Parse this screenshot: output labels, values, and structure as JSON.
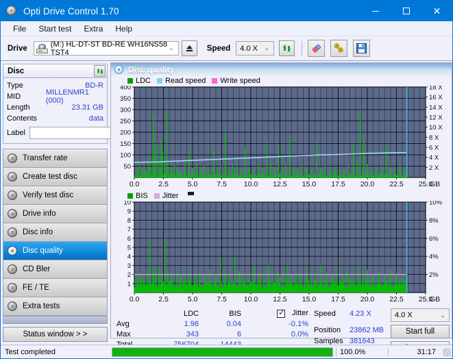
{
  "window": {
    "title": "Opti Drive Control 1.70",
    "icon": "disc-icon",
    "minimize": "–",
    "maximize": "□",
    "close": "✕"
  },
  "menu": {
    "items": [
      "File",
      "Start test",
      "Extra",
      "Help"
    ]
  },
  "toolbar": {
    "drive_label": "Drive",
    "drive_value": "(M:)   HL-DT-ST BD-RE  WH16NS58 TST4",
    "eject_icon": "eject-icon",
    "speed_label": "Speed",
    "speed_value": "4.0 X",
    "refresh_icon": "refresh-icon",
    "erase_icon": "eraser-icon",
    "tools_icon": "tools-icon",
    "save_icon": "save-icon"
  },
  "disc": {
    "header": "Disc",
    "refresh_icon": "refresh-icon",
    "rows": [
      {
        "key": "Type",
        "value": "BD-R"
      },
      {
        "key": "MID",
        "value": "MILLENMR1 (000)"
      },
      {
        "key": "Length",
        "value": "23.31 GB"
      },
      {
        "key": "Contents",
        "value": "data"
      }
    ],
    "label_key": "Label",
    "label_value": "",
    "label_placeholder": "",
    "disc_icon": "cd-icon"
  },
  "sidebar": {
    "items": [
      {
        "label": "Transfer rate",
        "active": false
      },
      {
        "label": "Create test disc",
        "active": false
      },
      {
        "label": "Verify test disc",
        "active": false
      },
      {
        "label": "Drive info",
        "active": false
      },
      {
        "label": "Disc info",
        "active": false
      },
      {
        "label": "Disc quality",
        "active": true
      },
      {
        "label": "CD Bler",
        "active": false
      },
      {
        "label": "FE / TE",
        "active": false
      },
      {
        "label": "Extra tests",
        "active": false
      }
    ],
    "status_button": "Status window > >"
  },
  "panel": {
    "title": "Disc quality",
    "icon": "disc-quality-icon"
  },
  "chart_data": [
    {
      "type": "line",
      "name": "top-chart",
      "title": "",
      "xlabel": "GB",
      "ylabel": "",
      "legend": [
        {
          "label": "LDC",
          "color": "#00a000"
        },
        {
          "label": "Read speed",
          "color": "#87cefa"
        },
        {
          "label": "Write speed",
          "color": "#ff66cc"
        }
      ],
      "legend_position": "top-left",
      "grid": true,
      "x": [
        0.0,
        2.5,
        5.0,
        7.5,
        10.0,
        12.5,
        15.0,
        17.5,
        20.0,
        22.5,
        25.0
      ],
      "xlim": [
        0,
        25.0
      ],
      "xtick_labels": [
        "0.0",
        "2.5",
        "5.0",
        "7.5",
        "10.0",
        "12.5",
        "15.0",
        "17.5",
        "20.0",
        "22.5",
        "25.0"
      ],
      "x_unit": "GB",
      "ylim": [
        0,
        400
      ],
      "ytick_labels": [
        "50",
        "100",
        "150",
        "200",
        "250",
        "300",
        "350",
        "400"
      ],
      "y2lim": [
        0,
        18
      ],
      "y2tick_labels": [
        "2 X",
        "4 X",
        "6 X",
        "8 X",
        "10 X",
        "12 X",
        "14 X",
        "16 X",
        "18 X"
      ],
      "data_end_gb": 23.4,
      "series": [
        {
          "name": "LDC",
          "color": "#00c000",
          "type": "bar",
          "baseline": 12,
          "spikes": [
            [
              0.25,
              40
            ],
            [
              0.45,
              60
            ],
            [
              0.6,
              35
            ],
            [
              0.85,
              52
            ],
            [
              1.0,
              30
            ],
            [
              1.25,
              95
            ],
            [
              1.45,
              45
            ],
            [
              1.62,
              280
            ],
            [
              1.78,
              120
            ],
            [
              1.95,
              150
            ],
            [
              2.1,
              70
            ],
            [
              2.3,
              165
            ],
            [
              2.45,
              110
            ],
            [
              2.6,
              60
            ],
            [
              2.78,
              300
            ],
            [
              2.95,
              48
            ],
            [
              3.2,
              38
            ],
            [
              3.45,
              55
            ],
            [
              3.7,
              42
            ],
            [
              4.0,
              35
            ],
            [
              4.35,
              70
            ],
            [
              4.7,
              130
            ],
            [
              5.0,
              40
            ],
            [
              5.35,
              60
            ],
            [
              5.7,
              45
            ],
            [
              6.0,
              52
            ],
            [
              6.4,
              38
            ],
            [
              6.8,
              118
            ],
            [
              7.1,
              42
            ],
            [
              7.45,
              55
            ],
            [
              7.8,
              200
            ],
            [
              8.1,
              46
            ],
            [
              8.45,
              60
            ],
            [
              8.8,
              50
            ],
            [
              9.1,
              40
            ],
            [
              9.5,
              130
            ],
            [
              9.85,
              44
            ],
            [
              10.2,
              38
            ],
            [
              10.6,
              58
            ],
            [
              11.0,
              42
            ],
            [
              11.4,
              150
            ],
            [
              11.7,
              60
            ],
            [
              12.0,
              46
            ],
            [
              12.4,
              145
            ],
            [
              12.7,
              40
            ],
            [
              13.0,
              52
            ],
            [
              13.35,
              170
            ],
            [
              13.7,
              48
            ],
            [
              14.0,
              40
            ],
            [
              14.4,
              58
            ],
            [
              14.8,
              44
            ],
            [
              15.2,
              36
            ],
            [
              15.6,
              150
            ],
            [
              16.0,
              42
            ],
            [
              16.4,
              55
            ],
            [
              16.8,
              48
            ],
            [
              17.2,
              40
            ],
            [
              17.6,
              46
            ],
            [
              18.0,
              38
            ],
            [
              18.4,
              52
            ],
            [
              18.8,
              150
            ],
            [
              19.1,
              62
            ],
            [
              19.4,
              300
            ],
            [
              19.7,
              160
            ],
            [
              20.0,
              58
            ],
            [
              20.4,
              46
            ],
            [
              20.8,
              42
            ],
            [
              21.2,
              50
            ],
            [
              21.6,
              140
            ],
            [
              22.0,
              44
            ],
            [
              22.4,
              48
            ],
            [
              22.8,
              54
            ],
            [
              23.2,
              40
            ]
          ]
        },
        {
          "name": "Read speed",
          "color": "#9fd8f7",
          "type": "line",
          "points": [
            [
              0.0,
              3.0
            ],
            [
              2.0,
              3.1
            ],
            [
              4.0,
              3.3
            ],
            [
              6.0,
              3.5
            ],
            [
              8.0,
              3.7
            ],
            [
              10.0,
              3.9
            ],
            [
              12.0,
              4.1
            ],
            [
              14.0,
              4.3
            ],
            [
              16.0,
              4.5
            ],
            [
              18.0,
              4.6
            ],
            [
              20.0,
              4.8
            ],
            [
              22.0,
              4.9
            ],
            [
              23.4,
              4.95
            ]
          ]
        },
        {
          "name": "Write speed",
          "color": "#ff66cc",
          "type": "line",
          "points": []
        }
      ]
    },
    {
      "type": "bar",
      "name": "bottom-chart",
      "title": "",
      "xlabel": "GB",
      "legend": [
        {
          "label": "BIS",
          "color": "#00a000"
        },
        {
          "label": "Jitter",
          "color": "#d8a8d8"
        }
      ],
      "legend_position": "top-left",
      "grid": true,
      "xlim": [
        0,
        25.0
      ],
      "xtick_labels": [
        "0.0",
        "2.5",
        "5.0",
        "7.5",
        "10.0",
        "12.5",
        "15.0",
        "17.5",
        "20.0",
        "22.5",
        "25.0"
      ],
      "x_unit": "GB",
      "ylim": [
        0,
        10
      ],
      "ytick_labels": [
        "1",
        "2",
        "3",
        "4",
        "5",
        "6",
        "7",
        "8",
        "9",
        "10"
      ],
      "y2lim": [
        0,
        10
      ],
      "y2tick_labels": [
        "2%",
        "4%",
        "6%",
        "8%",
        "10%"
      ],
      "data_end_gb": 23.4,
      "series": [
        {
          "name": "BIS",
          "color": "#00c000",
          "type": "bar",
          "baseline": 1.2,
          "spikes": [
            [
              0.25,
              2.0
            ],
            [
              0.5,
              2.2
            ],
            [
              0.8,
              1.8
            ],
            [
              1.1,
              2.4
            ],
            [
              1.35,
              6.0
            ],
            [
              1.6,
              3.0
            ],
            [
              1.85,
              2.2
            ],
            [
              2.1,
              2.8
            ],
            [
              2.4,
              2.0
            ],
            [
              2.6,
              6.0
            ],
            [
              2.9,
              2.2
            ],
            [
              3.2,
              1.9
            ],
            [
              3.6,
              2.4
            ],
            [
              4.0,
              2.0
            ],
            [
              4.4,
              2.6
            ],
            [
              4.8,
              2.1
            ],
            [
              5.2,
              2.0
            ],
            [
              5.6,
              2.3
            ],
            [
              6.0,
              1.9
            ],
            [
              6.5,
              2.5
            ],
            [
              7.0,
              2.0
            ],
            [
              7.4,
              4.0
            ],
            [
              7.8,
              2.2
            ],
            [
              8.2,
              2.0
            ],
            [
              8.6,
              4.0
            ],
            [
              9.0,
              2.4
            ],
            [
              9.4,
              2.0
            ],
            [
              9.9,
              2.2
            ],
            [
              10.3,
              3.0
            ],
            [
              10.7,
              2.1
            ],
            [
              11.1,
              2.6
            ],
            [
              11.5,
              3.0
            ],
            [
              11.9,
              2.0
            ],
            [
              12.3,
              2.4
            ],
            [
              12.7,
              2.2
            ],
            [
              13.1,
              3.0
            ],
            [
              13.5,
              2.0
            ],
            [
              13.9,
              2.3
            ],
            [
              14.3,
              2.0
            ],
            [
              14.8,
              2.8
            ],
            [
              15.2,
              2.0
            ],
            [
              15.6,
              2.4
            ],
            [
              16.0,
              3.0
            ],
            [
              16.5,
              2.2
            ],
            [
              17.0,
              2.0
            ],
            [
              17.4,
              2.6
            ],
            [
              17.9,
              2.1
            ],
            [
              18.3,
              2.4
            ],
            [
              18.7,
              2.0
            ],
            [
              19.2,
              3.0
            ],
            [
              19.6,
              2.2
            ],
            [
              20.0,
              2.5
            ],
            [
              20.5,
              2.0
            ],
            [
              21.0,
              2.3
            ],
            [
              21.5,
              2.0
            ],
            [
              22.0,
              2.6
            ],
            [
              22.5,
              2.1
            ],
            [
              23.0,
              2.0
            ]
          ]
        },
        {
          "name": "Jitter",
          "color": "#d8a8d8",
          "type": "line",
          "level": 2.0
        }
      ]
    }
  ],
  "stats": {
    "columns": [
      "",
      "LDC",
      "BIS",
      "Jitter"
    ],
    "jitter_checked": true,
    "rows": [
      {
        "label": "Avg",
        "ldc": "1.98",
        "bis": "0.04",
        "jitter": "-0.1%"
      },
      {
        "label": "Max",
        "ldc": "343",
        "bis": "6",
        "jitter": "0.0%"
      },
      {
        "label": "Total",
        "ldc": "756704",
        "bis": "14443",
        "jitter": ""
      }
    ]
  },
  "controls": {
    "speed_label": "Speed",
    "speed_value": "4.23 X",
    "position_label": "Position",
    "position_value": "23862 MB",
    "samples_label": "Samples",
    "samples_value": "381643",
    "speed_select": "4.0 X",
    "start_full": "Start full",
    "start_part": "Start part"
  },
  "statusbar": {
    "message": "Test completed",
    "progress_percent": 100.0,
    "progress_text": "100.0%",
    "elapsed": "31:17"
  },
  "colors": {
    "accent": "#0078d7",
    "plot_bg": "#5c6a8a",
    "green": "#00c000",
    "read_speed": "#9fd8f7",
    "write_speed": "#ff66cc",
    "jitter": "#d8a8d8",
    "value_text": "#2b3fd0"
  }
}
